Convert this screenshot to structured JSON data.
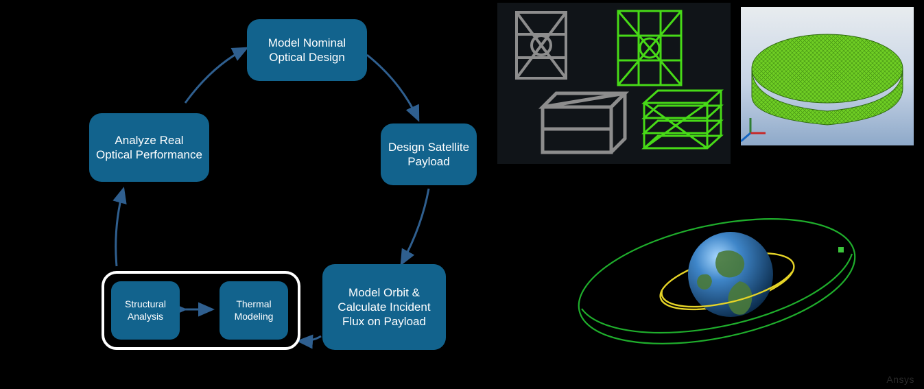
{
  "diagram": {
    "nodes": {
      "model_optical": "Model Nominal Optical Design",
      "design_payload": "Design Satellite Payload",
      "model_orbit": "Model Orbit & Calculate Incident Flux on Payload",
      "structural": "Structural Analysis",
      "thermal": "Thermal Modeling",
      "analyze_real": "Analyze Real Optical Performance"
    }
  },
  "watermark": "Ansys"
}
